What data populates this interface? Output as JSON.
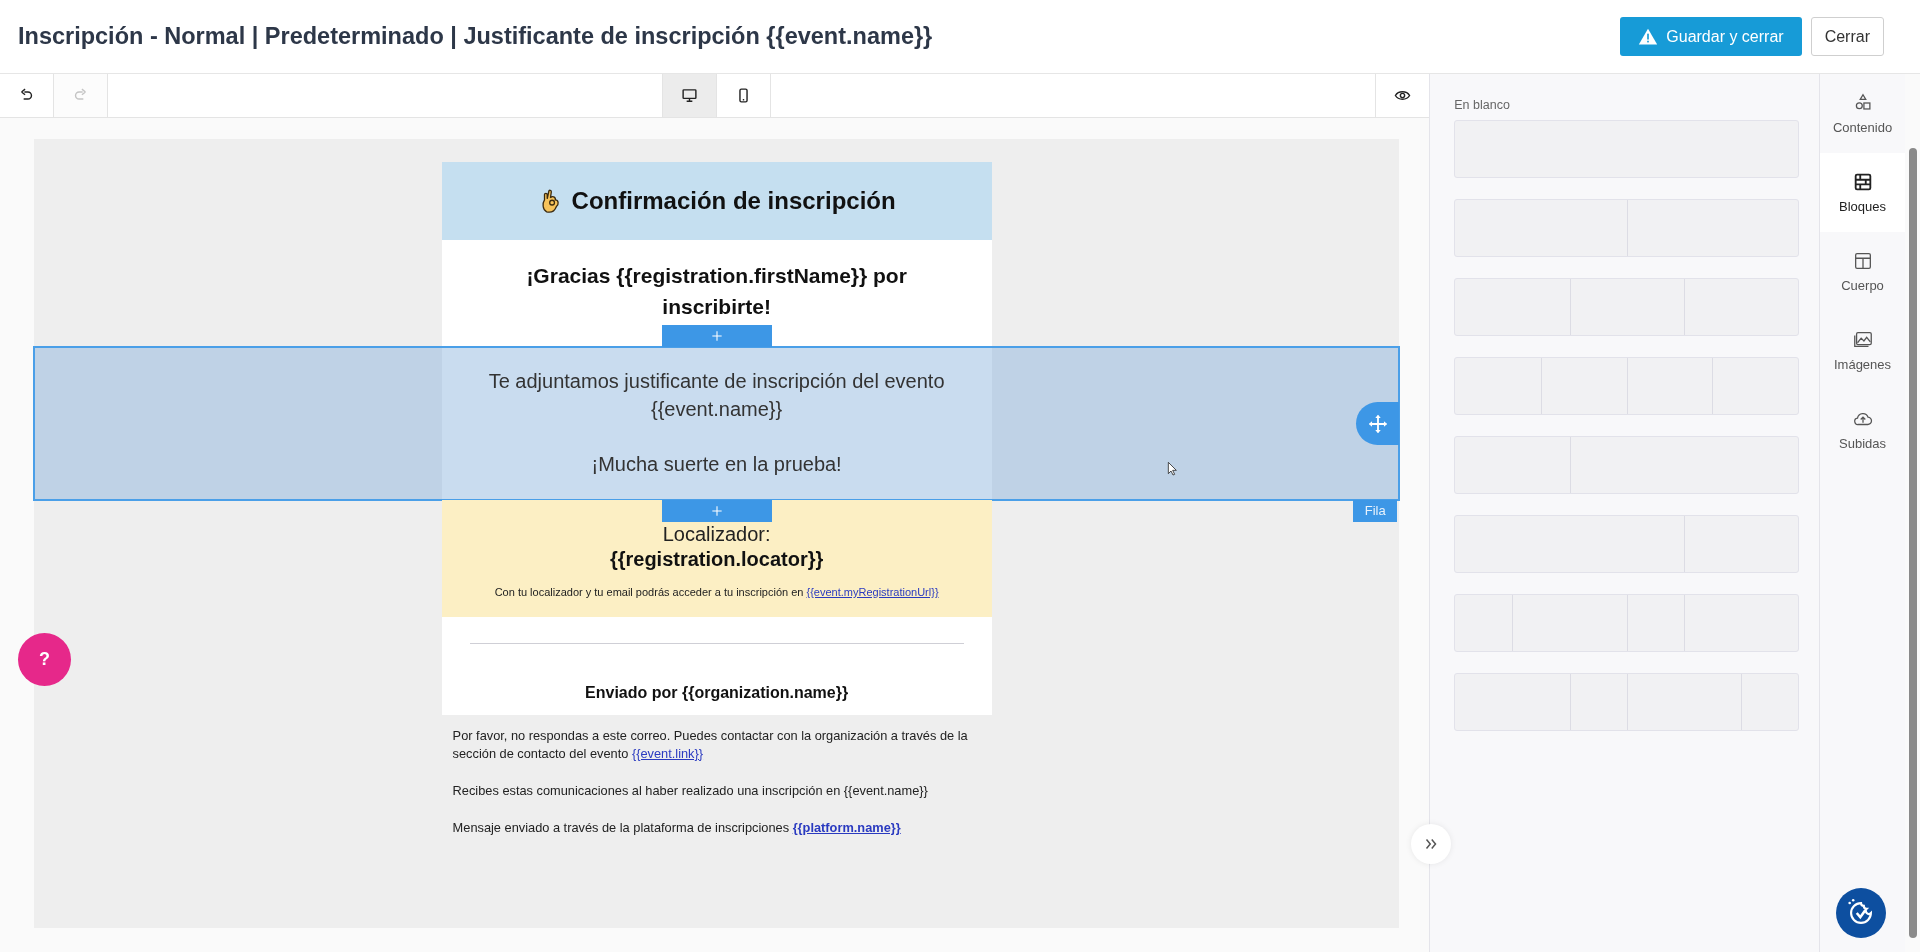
{
  "header": {
    "title": "Inscripción - Normal | Predeterminado | Justificante de inscripción {{event.name}}",
    "save_button": {
      "label": "Guardar y cerrar",
      "warning": true
    },
    "close_button": {
      "label": "Cerrar"
    }
  },
  "toolbar": {
    "history": [
      {
        "kind": "undo",
        "disabled": false
      },
      {
        "kind": "redo",
        "disabled": true
      }
    ],
    "view_modes": [
      {
        "kind": "desktop",
        "selected": true
      },
      {
        "kind": "mobile",
        "selected": false
      }
    ]
  },
  "email": {
    "selection_label": "Fila",
    "rows": [
      {
        "kind": "header",
        "selected": false,
        "title": "Confirmación de inscripción"
      },
      {
        "kind": "greeting",
        "selected": false,
        "text": "¡Gracias {{registration.firstName}} por inscribirte!"
      },
      {
        "kind": "message",
        "selected": true,
        "paragraphs": [
          "Te adjuntamos justificante de inscripción del evento {{event.name}}",
          "¡Mucha suerte en la prueba!"
        ]
      },
      {
        "kind": "locator",
        "selected": false,
        "label": "Localizador:",
        "value": "{{registration.locator}}",
        "note": {
          "text": "Con tu localizador y tu email podrás acceder a tu inscripción en ",
          "link": "{{event.myRegistrationUrl}}"
        }
      },
      {
        "kind": "sender",
        "selected": false,
        "text": "Enviado por {{organization.name}}"
      }
    ],
    "footer": [
      {
        "text": "Por favor, no respondas a este correo. Puedes contactar con la organización a través de la sección de contacto del evento ",
        "link": "{{event.link}}",
        "link_bold": false
      },
      {
        "text": "Recibes estas comunicaciones al haber realizado una inscripción en {{event.name}}"
      },
      {
        "text": "Mensaje enviado a través de la plataforma de inscripciones ",
        "link": "{{platform.name}}",
        "link_bold": true
      }
    ]
  },
  "help_button": {
    "label": "?"
  },
  "panel": {
    "section_title": "En blanco",
    "blocks": [
      {
        "kind": "one"
      },
      {
        "kind": "two"
      },
      {
        "kind": "three"
      },
      {
        "kind": "four"
      },
      {
        "kind": "narrow-wide"
      },
      {
        "kind": "wide-narrow"
      },
      {
        "kind": "narrow-wide-narrow-wide"
      },
      {
        "kind": "wide-narrow-wide-narrow"
      }
    ]
  },
  "tabs": [
    {
      "label": "Contenido",
      "selected": false
    },
    {
      "label": "Bloques",
      "selected": true
    },
    {
      "label": "Cuerpo",
      "selected": false
    },
    {
      "label": "Imágenes",
      "selected": false
    },
    {
      "label": "Subidas",
      "selected": false
    }
  ]
}
